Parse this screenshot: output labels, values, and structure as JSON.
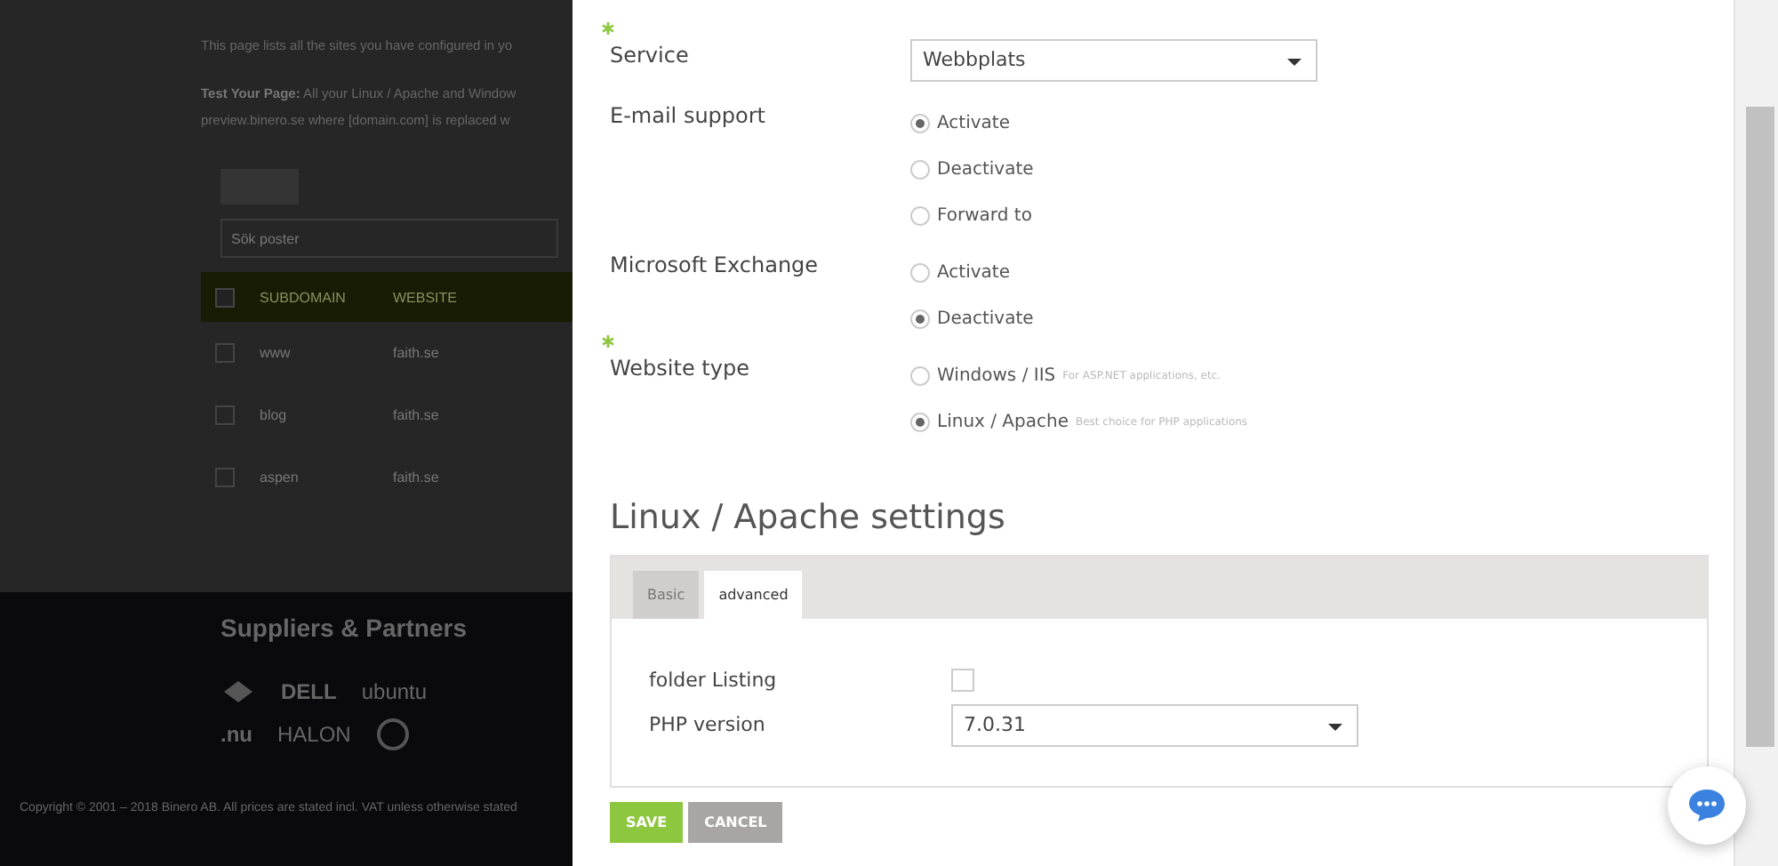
{
  "background_page": {
    "intro": "This page lists all the sites you have configured in yo",
    "test_label": "Test Your Page:",
    "test_text": "All your Linux / Apache and Window",
    "test_text2": "preview.binero.se where [domain.com] is replaced w",
    "search": {
      "placeholder": "Sök poster"
    },
    "table": {
      "header_checked": false,
      "columns": [
        "SUBDOMAIN",
        "WEBSITE"
      ],
      "rows": [
        {
          "checked": false,
          "cells": [
            "www",
            "faith.se"
          ]
        },
        {
          "checked": false,
          "cells": [
            "blog",
            "faith.se"
          ]
        },
        {
          "checked": false,
          "cells": [
            "aspen",
            "faith.se"
          ]
        }
      ]
    },
    "footer": {
      "title": "Suppliers & Partners",
      "logos": [
        "DELL",
        "ubuntu",
        ".nu",
        "HALON"
      ],
      "copyright": "Copyright © 2001 – 2018 Binero AB. All prices are stated incl. VAT unless otherwise stated"
    }
  },
  "form": {
    "fields": [
      {
        "kind": "select",
        "label": "Service",
        "required": true,
        "value": "Webbplats"
      },
      {
        "kind": "radio",
        "label": "E-mail support",
        "required": false,
        "options": [
          {
            "label": "Activate",
            "selected": true
          },
          {
            "label": "Deactivate",
            "selected": false
          },
          {
            "label": "Forward to",
            "selected": false
          }
        ]
      },
      {
        "kind": "radio",
        "label": "Microsoft Exchange",
        "required": false,
        "options": [
          {
            "label": "Activate",
            "selected": false
          },
          {
            "label": "Deactivate",
            "selected": true
          }
        ]
      },
      {
        "kind": "radio",
        "label": "Website type",
        "required": true,
        "options": [
          {
            "label": "Windows / IIS",
            "hint": "For ASP.NET applications, etc.",
            "selected": false
          },
          {
            "label": "Linux / Apache",
            "hint": "Best choice for PHP applications",
            "selected": true
          }
        ]
      }
    ],
    "settings_title": "Linux / Apache settings",
    "tabs": [
      {
        "label": "Basic",
        "selected": false
      },
      {
        "label": "advanced",
        "selected": true
      }
    ],
    "settings": [
      {
        "kind": "checkbox",
        "label": "folder Listing",
        "checked": false
      },
      {
        "kind": "select",
        "label": "PHP version",
        "value": "7.0.31"
      }
    ],
    "buttons": [
      {
        "kind": "primary",
        "label": "SAVE"
      },
      {
        "kind": "secondary",
        "label": "CANCEL"
      }
    ]
  }
}
